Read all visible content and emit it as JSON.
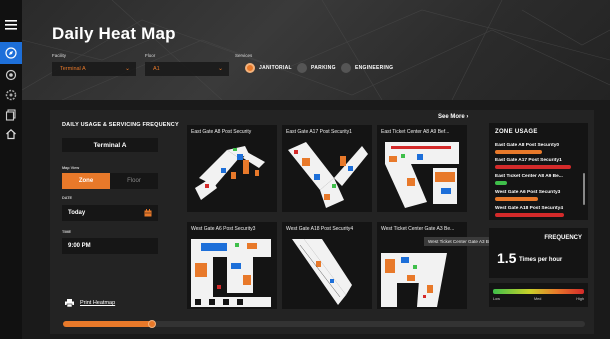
{
  "header": {
    "title": "Daily Heat Map",
    "facility_label": "Facility",
    "facility_value": "Terminal A",
    "floor_label": "Floor",
    "floor_value": "A1",
    "services_label": "Services",
    "services": [
      {
        "label": "JANITORIAL",
        "selected": true
      },
      {
        "label": "PARKING",
        "selected": false
      },
      {
        "label": "ENGINEERING",
        "selected": false
      }
    ]
  },
  "nav": {
    "icons": [
      "menu-icon",
      "compass-icon",
      "map-pin-icon",
      "settings-icon",
      "copy-icon",
      "home-icon"
    ],
    "active_index": 1
  },
  "panel": {
    "title": "DAILY USAGE & SERVICING FREQUENCY",
    "terminal": "Terminal A",
    "map_view_label": "Map View",
    "view_zone": "Zone",
    "view_floor": "Floor",
    "date_label": "DATE",
    "date_value": "Today",
    "time_label": "TIME",
    "time_value": "9:00 PM",
    "print_label": "Print Heatmap",
    "see_more": "See More"
  },
  "tiles": [
    {
      "caption": "East Gate A8 Post Security"
    },
    {
      "caption": "East Gate A17 Post Security1"
    },
    {
      "caption": "East Ticket Center A8 A9 Bef..."
    },
    {
      "caption": "West Gate A6 Post Security3"
    },
    {
      "caption": "West Gate A18 Post Security4"
    },
    {
      "caption": "West Ticket Center Gate A3 Be..."
    }
  ],
  "tooltip": "West Ticket Center Gate A3 Before Security5",
  "zone_usage": {
    "title": "ZONE USAGE",
    "items": [
      {
        "name": "East Gate A8 Post Security0",
        "color": "#e8792a",
        "level": 0.55
      },
      {
        "name": "East Gate A17 Post Security1",
        "color": "#d42a2a",
        "level": 0.88
      },
      {
        "name": "East Ticket Center A8 A9 Be...",
        "color": "#3fbf4a",
        "level": 0.14
      },
      {
        "name": "West Gate A6 Post Security3",
        "color": "#e8792a",
        "level": 0.5
      },
      {
        "name": "West Gate A18 Post Security4",
        "color": "#d42a2a",
        "level": 0.8
      }
    ]
  },
  "frequency": {
    "title": "FREQUENCY",
    "value": "1.5",
    "unit": "Times per hour"
  },
  "legend": {
    "low": "Low",
    "med": "Med",
    "high": "High"
  },
  "timeline": {
    "progress": 0.17
  },
  "colors": {
    "accent": "#e8792a",
    "nav_active": "#1d6fd9",
    "high": "#d42a2a",
    "low": "#3fbf4a"
  }
}
